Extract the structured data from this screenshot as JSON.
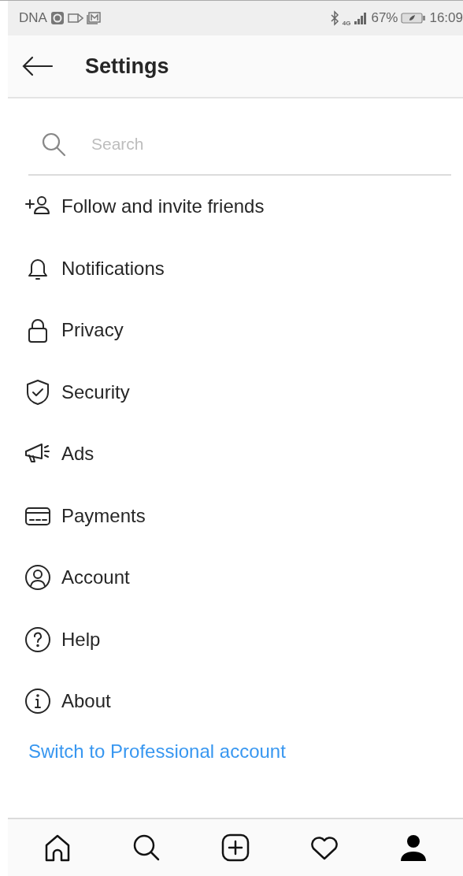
{
  "status_bar": {
    "carrier": "DNA",
    "network": "4G",
    "battery": "67%",
    "time": "16:09"
  },
  "header": {
    "title": "Settings"
  },
  "search": {
    "placeholder": "Search"
  },
  "items": [
    {
      "kind": "follow",
      "label": "Follow and invite friends"
    },
    {
      "kind": "notifications",
      "label": "Notifications"
    },
    {
      "kind": "privacy",
      "label": "Privacy"
    },
    {
      "kind": "security",
      "label": "Security"
    },
    {
      "kind": "ads",
      "label": "Ads"
    },
    {
      "kind": "payments",
      "label": "Payments"
    },
    {
      "kind": "account",
      "label": "Account"
    },
    {
      "kind": "help",
      "label": "Help"
    },
    {
      "kind": "about",
      "label": "About"
    }
  ],
  "link": "Switch to Professional account",
  "nav": [
    {
      "kind": "home",
      "selected": false
    },
    {
      "kind": "search",
      "selected": false
    },
    {
      "kind": "add",
      "selected": false
    },
    {
      "kind": "activity",
      "selected": false
    },
    {
      "kind": "profile",
      "selected": true
    }
  ]
}
